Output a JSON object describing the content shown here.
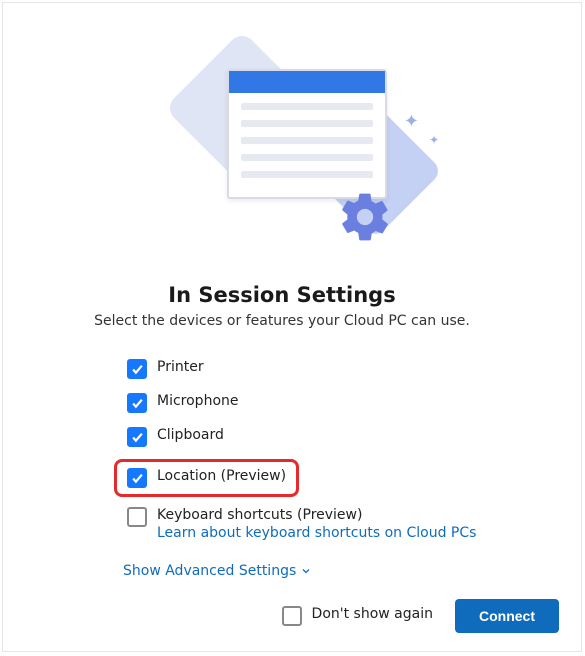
{
  "dialog": {
    "title": "In Session Settings",
    "subtitle": "Select the devices or features your Cloud PC can use."
  },
  "options": {
    "printer": {
      "label": "Printer",
      "checked": true
    },
    "microphone": {
      "label": "Microphone",
      "checked": true
    },
    "clipboard": {
      "label": "Clipboard",
      "checked": true
    },
    "location": {
      "label": "Location (Preview)",
      "checked": true,
      "highlighted": true
    },
    "keyboard": {
      "label": "Keyboard shortcuts (Preview)",
      "checked": false,
      "learn_link": "Learn about keyboard shortcuts on Cloud PCs"
    }
  },
  "advanced_toggle": "Show Advanced Settings",
  "footer": {
    "dont_show_label": "Don't show again",
    "dont_show_checked": false,
    "connect_label": "Connect"
  },
  "colors": {
    "accent": "#0f6cbd",
    "checkbox_fill": "#1677ff",
    "highlight_border": "#e6292b"
  }
}
